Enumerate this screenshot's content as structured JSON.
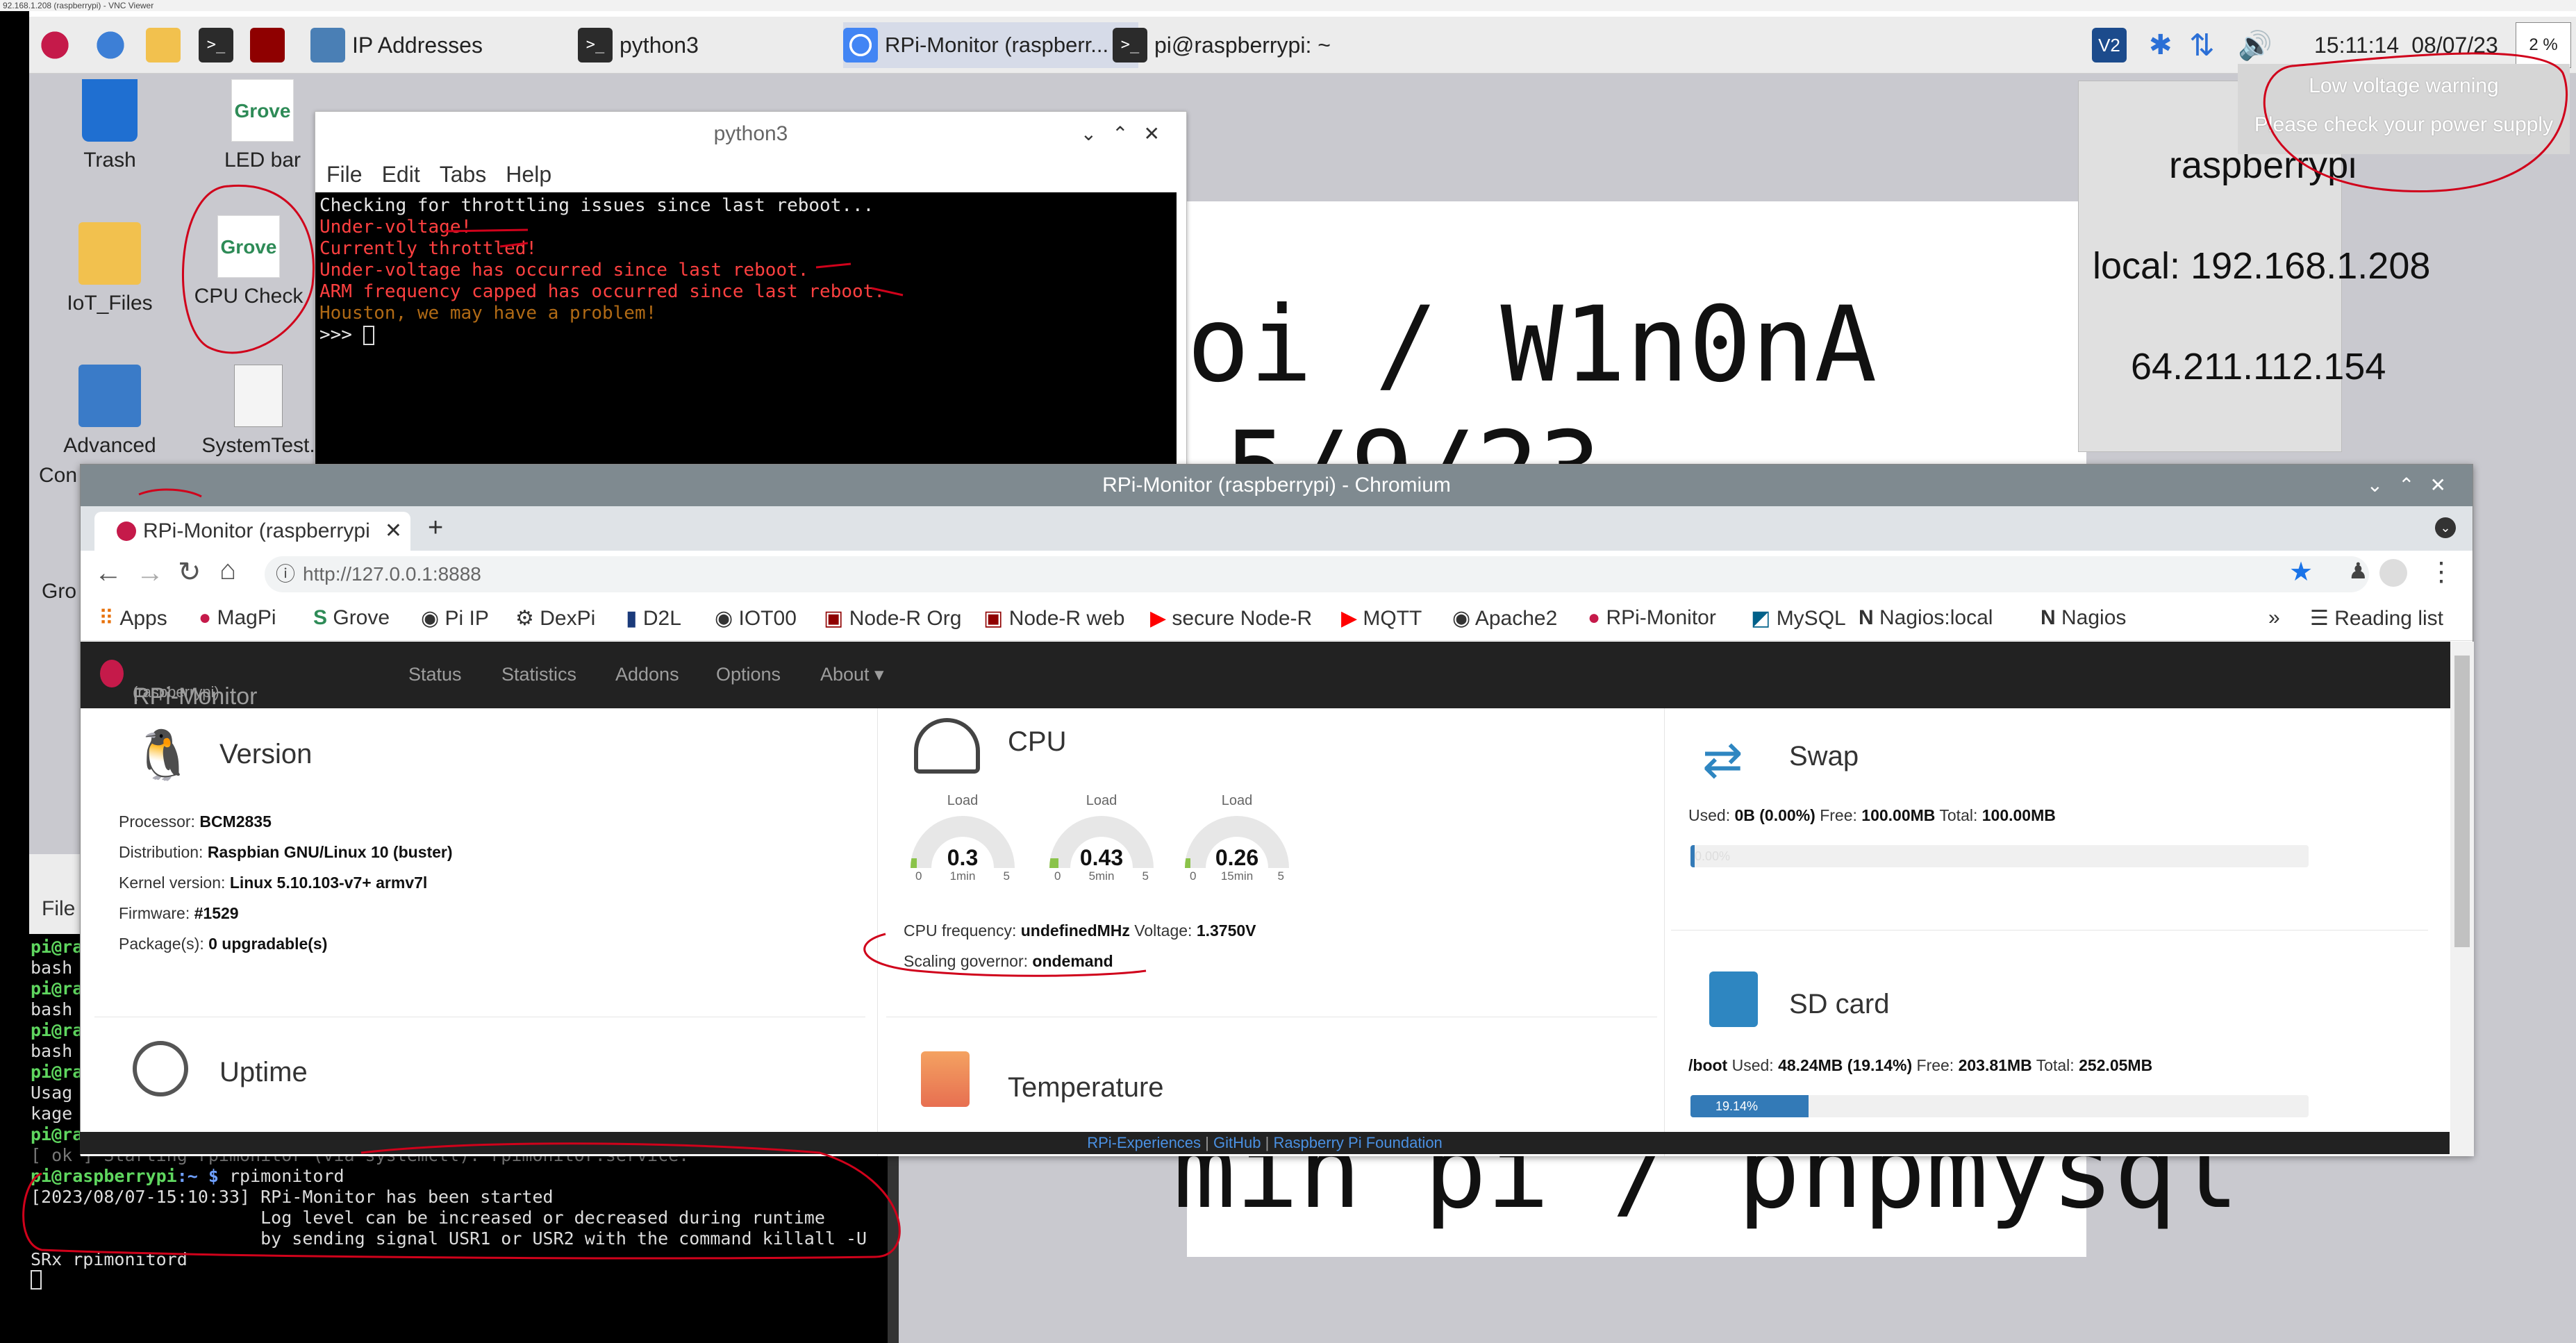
{
  "vnc_title": "92.168.1.208 (raspberrypi) - VNC Viewer",
  "taskbar": {
    "windows": [
      "IP Addresses",
      "python3",
      "RPi-Monitor (raspberr...",
      "pi@raspberrypi: ~"
    ],
    "clock": "15:11:14",
    "date": "08/07/23",
    "cpu": "2 %"
  },
  "desktop_icons": [
    "Trash",
    "LED bar",
    "IoT_Files",
    "CPU Check",
    "Advanced",
    "SystemTest.",
    "Con",
    "Gro"
  ],
  "python_window": {
    "title": "python3",
    "menu": [
      "File",
      "Edit",
      "Tabs",
      "Help"
    ],
    "lines": [
      "Checking for throttling issues since last reboot...",
      "Under-voltage!",
      "Currently throttled!",
      "Under-voltage has occurred since last reboot.",
      "ARM frequency capped has occurred since last reboot.",
      "Houston, we may have a problem!",
      ">>> "
    ]
  },
  "bg_text": {
    "line1": "oi / W1n0nA",
    "line2": "5/9/23",
    "line3": "min  pi / phpmysql"
  },
  "ip_window": {
    "hostname": "raspberrypi",
    "local": "local: 192.168.1.208",
    "public": "64.211.112.154"
  },
  "notification": {
    "title": "Low voltage warning",
    "body": "Please check your power supply"
  },
  "terminal2": {
    "menu_file": "File",
    "prefix_lines": [
      "pi@ra",
      "bash",
      "pi@ra",
      "bash",
      "pi@ra",
      "bash",
      "pi@ra",
      "Usag",
      "kage",
      "pi@ra"
    ],
    "line_ok": "[ ok ] Starting rpimonitor (via systemctl): rpimonitor.service.",
    "prompt_user": "pi@raspberrypi",
    "prompt_path": ":~ $ ",
    "command": "rpimonitord",
    "log1": "[2023/08/07-15:10:33] RPi-Monitor has been started",
    "log2": "                      Log level can be increased or decreased during runtime",
    "log3": "                      by sending signal USR1 or USR2 with the command killall -U",
    "log4": "SRx rpimonitord"
  },
  "chromium": {
    "window_title": "RPi-Monitor (raspberrypi) - Chromium",
    "tab_label": "RPi-Monitor (raspberrypi",
    "url": "http://127.0.0.1:8888",
    "bookmarks": [
      "Apps",
      "MagPi",
      "Grove",
      "Pi IP",
      "DexPi",
      "D2L",
      "IOT00",
      "Node-R Org",
      "Node-R web",
      "secure Node-R",
      "MQTT",
      "Apache2",
      "RPi-Monitor",
      "MySQL",
      "Nagios:local",
      "Nagios"
    ],
    "reading_list": "Reading list",
    "more": "»"
  },
  "rpimonitor": {
    "brand": "RPi-Monitor",
    "brand_host": "(raspberrypi)",
    "nav": [
      "Status",
      "Statistics",
      "Addons",
      "Options",
      "About ▾"
    ],
    "version": {
      "title": "Version",
      "rows": [
        {
          "k": "Processor: ",
          "v": "BCM2835"
        },
        {
          "k": "Distribution: ",
          "v": "Raspbian GNU/Linux 10 (buster)"
        },
        {
          "k": "Kernel version: ",
          "v": "Linux 5.10.103-v7+ armv7l"
        },
        {
          "k": "Firmware: ",
          "v": "#1529"
        },
        {
          "k": "Package(s): ",
          "v": "0 upgradable(s)"
        }
      ]
    },
    "uptime_title": "Uptime",
    "cpu": {
      "title": "CPU",
      "gauges": [
        {
          "label": "Load",
          "value": "0.3",
          "sub": "1min",
          "min": "0",
          "max": "5",
          "level": 0.06
        },
        {
          "label": "Load",
          "value": "0.43",
          "sub": "5min",
          "min": "0",
          "max": "5",
          "level": 0.086
        },
        {
          "label": "Load",
          "value": "0.26",
          "sub": "15min",
          "min": "0",
          "max": "5",
          "level": 0.052
        }
      ],
      "freq_label": "CPU frequency: ",
      "freq_value": "undefinedMHz",
      "voltage_label": " Voltage: ",
      "voltage_value": "1.3750V",
      "gov_label": "Scaling governor: ",
      "gov_value": "ondemand"
    },
    "temperature_title": "Temperature",
    "swap": {
      "title": "Swap",
      "used_label": "Used: ",
      "used": "0B (0.00%)",
      "free_label": " Free: ",
      "free": "100.00MB",
      "total_label": " Total: ",
      "total": "100.00MB",
      "bar_label": "0.00%",
      "level": 0.0
    },
    "sdcard": {
      "title": "SD card",
      "mount": "/boot",
      "used_label": " Used: ",
      "used": "48.24MB (19.14%)",
      "free_label": " Free: ",
      "free": "203.81MB",
      "total_label": " Total: ",
      "total": "252.05MB",
      "bar_label": "19.14%",
      "level": 0.1914
    },
    "footer": [
      "RPi-Experiences",
      " | ",
      "GitHub",
      " | ",
      "Raspberry Pi Foundation"
    ]
  },
  "colors": {
    "annotation_red": "#d0021b",
    "navbar": "#222222",
    "link_blue": "#4a90e2"
  }
}
